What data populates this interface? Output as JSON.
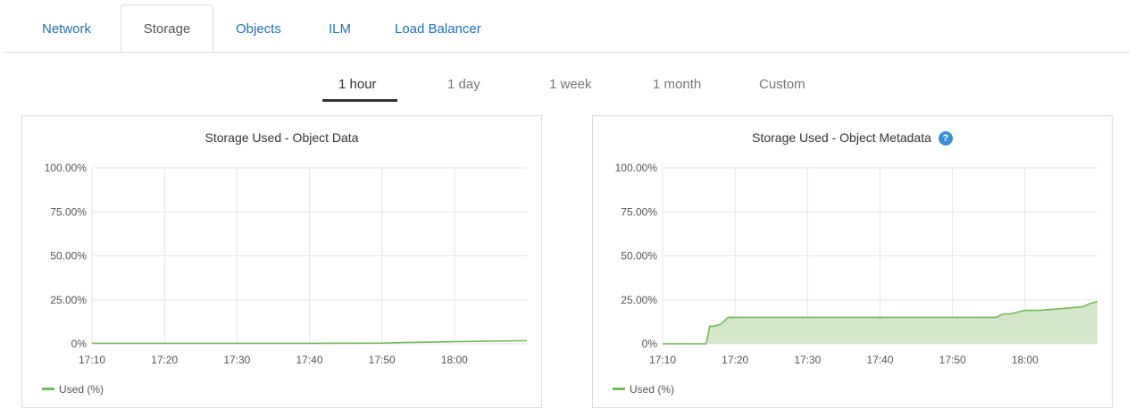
{
  "tabs": {
    "items": [
      "Network",
      "Storage",
      "Objects",
      "ILM",
      "Load Balancer"
    ],
    "active": "Storage"
  },
  "time_ranges": {
    "items": [
      "1 hour",
      "1 day",
      "1 week",
      "1 month",
      "Custom"
    ],
    "active": "1 hour"
  },
  "colors": {
    "link": "#1f6fb5",
    "series_line": "#73b85c",
    "series_fill": "#d4e8c9",
    "help_icon": "#3b8fd6"
  },
  "charts": {
    "object_data": {
      "title": "Storage Used - Object Data",
      "legend_label": "Used (%)"
    },
    "object_metadata": {
      "title": "Storage Used - Object Metadata",
      "legend_label": "Used (%)",
      "help_icon": "question-circle-icon"
    }
  },
  "chart_data": [
    {
      "type": "line",
      "title": "Storage Used - Object Data",
      "xlabel": "",
      "ylabel": "",
      "x_ticks": [
        "17:10",
        "17:20",
        "17:30",
        "17:40",
        "17:50",
        "18:00"
      ],
      "y_ticks": [
        "0%",
        "25.00%",
        "50.00%",
        "75.00%",
        "100.00%"
      ],
      "ylim": [
        0,
        100
      ],
      "xlim": [
        "17:10",
        "18:10"
      ],
      "grid": true,
      "legend_position": "bottom-left",
      "series": [
        {
          "name": "Used (%)",
          "fill": false,
          "x": [
            "17:10",
            "17:20",
            "17:30",
            "17:40",
            "17:50",
            "17:53",
            "17:56",
            "18:00",
            "18:05",
            "18:10"
          ],
          "y": [
            0.3,
            0.3,
            0.3,
            0.3,
            0.4,
            0.7,
            0.9,
            1.2,
            1.5,
            1.8
          ]
        }
      ]
    },
    {
      "type": "area",
      "title": "Storage Used - Object Metadata",
      "xlabel": "",
      "ylabel": "",
      "x_ticks": [
        "17:10",
        "17:20",
        "17:30",
        "17:40",
        "17:50",
        "18:00"
      ],
      "y_ticks": [
        "0%",
        "25.00%",
        "50.00%",
        "75.00%",
        "100.00%"
      ],
      "ylim": [
        0,
        100
      ],
      "xlim": [
        "17:10",
        "18:10"
      ],
      "grid": true,
      "legend_position": "bottom-left",
      "series": [
        {
          "name": "Used (%)",
          "fill": true,
          "x": [
            "17:10",
            "17:16",
            "17:16.5",
            "17:17",
            "17:18",
            "17:19",
            "17:50",
            "17:56",
            "17:57",
            "17:58",
            "17:59",
            "18:00",
            "18:02",
            "18:05",
            "18:08",
            "18:09",
            "18:10"
          ],
          "y": [
            0,
            0,
            10,
            10,
            11,
            15,
            15,
            15,
            17,
            17,
            18,
            19,
            19,
            20,
            21,
            23,
            24
          ]
        }
      ]
    }
  ]
}
